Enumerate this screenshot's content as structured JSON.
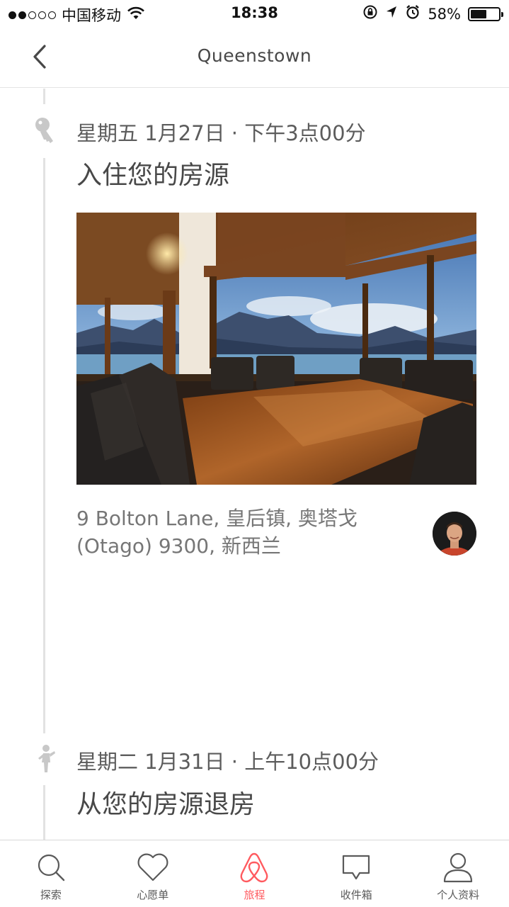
{
  "status_bar": {
    "carrier": "中国移动",
    "time": "18:38",
    "battery_percent": "58%",
    "battery_level": 0.58,
    "signal_bars_filled": 2,
    "signal_bars_total": 5,
    "icons": [
      "wifi-icon",
      "rotation-lock-icon",
      "location-arrow-icon",
      "alarm-icon",
      "battery-icon"
    ]
  },
  "nav": {
    "title": "Queenstown",
    "back_icon": "chevron-left-icon"
  },
  "events": [
    {
      "icon": "key-icon",
      "datetime": "星期五 1月27日 · 下午3点00分",
      "title": "入住您的房源"
    },
    {
      "icon": "person-walking-out-icon",
      "datetime": "星期二 1月31日 · 上午10点00分",
      "title": "从您的房源退房"
    }
  ],
  "listing": {
    "photo": "dining-room-lake-view-photo",
    "address_line1": "9 Bolton Lane, 皇后镇, 奥塔戈",
    "address_line2": "(Otago) 9300, 新西兰",
    "host_avatar": "host-avatar"
  },
  "tabs": [
    {
      "label": "探索",
      "icon": "search-icon",
      "active": false
    },
    {
      "label": "心愿单",
      "icon": "heart-icon",
      "active": false
    },
    {
      "label": "旅程",
      "icon": "airbnb-logo-icon",
      "active": true
    },
    {
      "label": "收件箱",
      "icon": "chat-bubble-icon",
      "active": false
    },
    {
      "label": "个人资料",
      "icon": "person-icon",
      "active": false
    }
  ],
  "colors": {
    "accent": "#ff5a5f",
    "text": "#484848",
    "timeline": "#e2e2e2",
    "icon_gray": "#c8c8c8"
  }
}
